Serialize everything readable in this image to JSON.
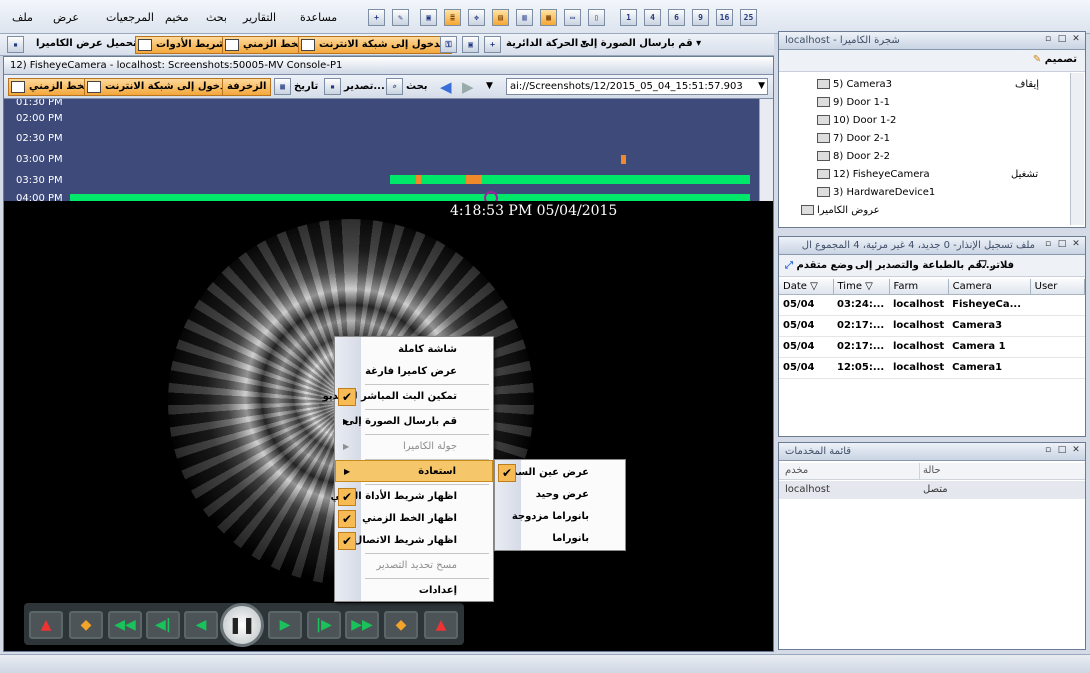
{
  "menubar": {
    "items": [
      "ملف",
      "عرض",
      "المرجعيات",
      "مخيم",
      "بحث",
      "التقارير",
      "مساعدة"
    ],
    "layout_icons": [
      "1",
      "4",
      "6",
      "9",
      "16",
      "25"
    ]
  },
  "main_toolbar": {
    "load_camera_view": "تحميل عرض الكاميرا",
    "send_image_to": "قم بارسال الصورة إلى",
    "circular_motion": "الحركة الدائرية",
    "web_login": "الدخول إلى شبكة الانترنت",
    "timeline": "الخط الزمني",
    "toolbar_strip": "شريط الأدوات"
  },
  "camera_panel": {
    "title": "12) FisheyeCamera - localhost: Screenshots:50005-MV Console-P1",
    "toolbar": {
      "timeline": "الخط الزمني",
      "web_login": "الدخول إلى شبكة الانترنت",
      "decoration": "الزخرفة",
      "date": "تاريخ",
      "export": "تصدير...",
      "search": "بحث",
      "path": "ai://Screenshots/12/2015_05_04_15:51:57.903"
    },
    "timeline_labels": [
      "01:30 PM",
      "02:00 PM",
      "02:30 PM",
      "03:00 PM",
      "03:30 PM",
      "04:00 PM"
    ],
    "timestamp": "4:18:53 PM 05/04/2015"
  },
  "context_menu": {
    "items": [
      {
        "label": "شاشة كاملة",
        "checked": false,
        "disabled": false,
        "submenu": false
      },
      {
        "label": "عرض كاميرا فارغة",
        "checked": false,
        "disabled": false,
        "submenu": false
      },
      {
        "label": "تمكين البث المباشر للفيديو",
        "checked": true,
        "disabled": false,
        "submenu": false
      },
      {
        "label": "قم بارسال الصورة إلى",
        "checked": false,
        "disabled": false,
        "submenu": true
      },
      {
        "label": "جولة الكاميرا",
        "checked": false,
        "disabled": true,
        "submenu": true
      },
      {
        "label": "استعادة",
        "checked": false,
        "disabled": false,
        "submenu": true,
        "highlighted": true
      },
      {
        "label": "اظهار شريط الأداة النصي",
        "checked": true,
        "disabled": false,
        "submenu": false
      },
      {
        "label": "اظهار الخط الزمني",
        "checked": true,
        "disabled": false,
        "submenu": false
      },
      {
        "label": "اظهار شريط الاتصال",
        "checked": true,
        "disabled": false,
        "submenu": false
      },
      {
        "label": "مسح تحديد التصدير",
        "checked": false,
        "disabled": true,
        "submenu": false
      },
      {
        "label": "إعدادات",
        "checked": false,
        "disabled": false,
        "submenu": false
      }
    ],
    "submenu": [
      {
        "label": "عرض عين السمكة",
        "checked": true
      },
      {
        "label": "عرض وحيد",
        "checked": false
      },
      {
        "label": "بانوراما مزدوجة",
        "checked": false
      },
      {
        "label": "بانوراما",
        "checked": false
      }
    ]
  },
  "camera_tree": {
    "title": "localhost - شجرة الكاميرا",
    "design_label": "تصميم",
    "items": [
      {
        "label": "5) Camera3",
        "status": "إيقاف"
      },
      {
        "label": "9) Door 1-1",
        "status": ""
      },
      {
        "label": "10) Door 1-2",
        "status": ""
      },
      {
        "label": "7) Door 2-1",
        "status": ""
      },
      {
        "label": "8) Door 2-2",
        "status": ""
      },
      {
        "label": "12) FisheyeCamera",
        "status": "تشغيل"
      },
      {
        "label": "3) HardwareDevice1",
        "status": ""
      },
      {
        "label": "عروض الكاميرا",
        "status": ""
      }
    ]
  },
  "alarm_log": {
    "title": "ملف تسجيل الإنذار- 0 جديد، 4 غير مرئية، 4 المجموع ال",
    "toolbar": {
      "filter": "فلاتر",
      "print_export": "قم بالطباعة والتصدير إلى...",
      "advanced": "وضع متقدم"
    },
    "columns": [
      "Date",
      "Time",
      "Farm",
      "Camera",
      "User"
    ],
    "rows": [
      [
        "05/04",
        "03:24:...",
        "localhost",
        "FisheyeCa...",
        ""
      ],
      [
        "05/04",
        "02:17:...",
        "localhost",
        "Camera3",
        ""
      ],
      [
        "05/04",
        "02:17:...",
        "localhost",
        "Camera 1",
        ""
      ],
      [
        "05/04",
        "12:05:...",
        "localhost",
        "Camera1",
        ""
      ]
    ]
  },
  "servers": {
    "title": "قائمة المخدمات",
    "columns": [
      "مخدم",
      "حالة"
    ],
    "rows": [
      [
        "localhost",
        "متصل"
      ]
    ]
  }
}
